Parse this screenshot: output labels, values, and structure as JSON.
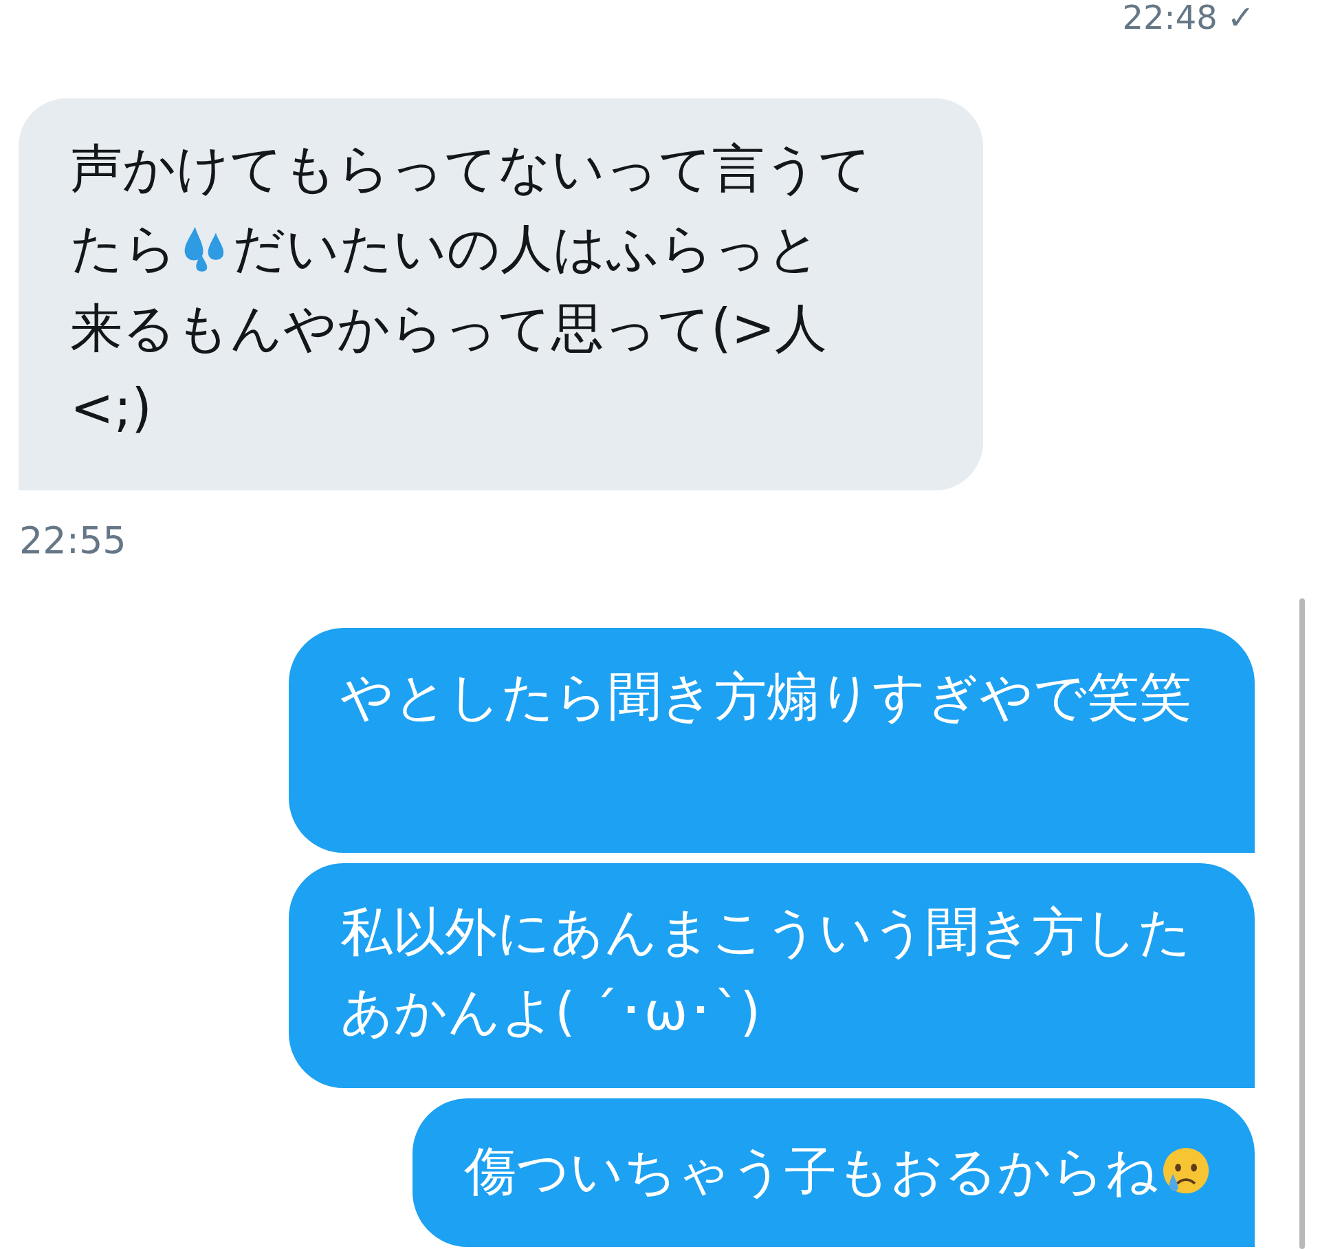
{
  "top_timestamp": {
    "time": "22:48",
    "receipt": "✓"
  },
  "items": [
    {
      "kind": "received_message",
      "lines": [
        [
          {
            "kind": "text",
            "text": "声かけてもらってないって言うて"
          }
        ],
        [
          {
            "kind": "text",
            "text": "たら"
          },
          {
            "kind": "sweat"
          },
          {
            "kind": "text",
            "text": "だいたいの人はふらっと"
          }
        ],
        [
          {
            "kind": "text",
            "text": "来るもんやからって思って(>人"
          }
        ],
        [
          {
            "kind": "text",
            "text": "<;)"
          }
        ]
      ]
    },
    {
      "kind": "timestamp",
      "text": "22:55"
    },
    {
      "kind": "sent_message",
      "lines": [
        [
          {
            "kind": "text",
            "text": "やとしたら聞き方煽りすぎやで笑笑"
          }
        ]
      ]
    },
    {
      "kind": "sent_message",
      "lines": [
        [
          {
            "kind": "text",
            "text": "私以外にあんまこういう聞き方したあかんよ( ´･ω･`)"
          }
        ]
      ]
    },
    {
      "kind": "sent_message",
      "lines": [
        [
          {
            "kind": "text",
            "text": "傷ついちゃう子もおるからね"
          },
          {
            "kind": "crying"
          }
        ]
      ]
    }
  ]
}
